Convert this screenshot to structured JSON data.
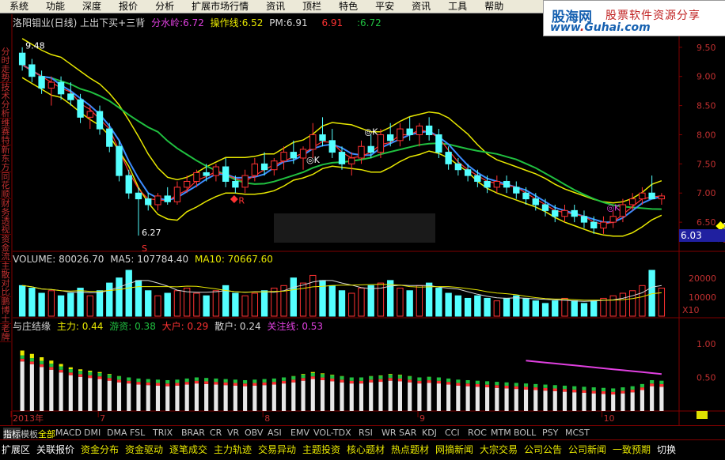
{
  "menu": [
    "系统",
    "功能",
    "深度",
    "报价",
    "分析",
    "扩展市场行情",
    "资讯",
    "顶栏",
    "特色",
    "平安",
    "资讯",
    "工具",
    "帮助"
  ],
  "menu_right": "交",
  "logo": {
    "brand": "股海网",
    "tagline": "股票软件资源分享",
    "url_left": "www",
    "url_dot": ".",
    "url_right": "Guhai.com"
  },
  "sidebar_tabs": [
    "分时走势",
    "技术分析",
    "维赛特",
    "新东方",
    "同花顺",
    "财务透视",
    "资金流",
    "主散对比",
    "鹏博士",
    "老牌"
  ],
  "title_line": {
    "name": "洛阳钼业(日线) 上出下买+三背",
    "fsl_label": "分水岭:",
    "fsl_value": "6.72",
    "czx_label": "操作线:",
    "czx_value": "6.52",
    "pm_label": "PM:",
    "pm_value": "6.91",
    "v1": "6.91",
    "v2": ":6.72"
  },
  "current_price": "6.03",
  "volume_label": {
    "vol": "VOLUME: 80026.70",
    "ma5": "MA5: 107784.40",
    "ma10": "MA10: 70667.60"
  },
  "zl_label": {
    "name": "与庄结缘",
    "zl": "主力: 0.44",
    "yz": "游资: 0.38",
    "dh": "大户: 0.29",
    "sh": "散户: 0.24",
    "gz": "关注线: 0.53"
  },
  "bottombar1": [
    "指标",
    "模板",
    "全部",
    "MACD",
    "DMI",
    "DMA",
    "FSL",
    "TRIX",
    "BRAR",
    "CR",
    "VR",
    "OBV",
    "ASI",
    "EMV",
    "VOL-TDX",
    "RSI",
    "WR",
    "SAR",
    "KDJ",
    "CCI",
    "ROC",
    "MTM",
    "BOLL",
    "PSY",
    "MCST"
  ],
  "bottombar2": [
    "扩展区",
    "关联报价",
    "资金分布",
    "资金驱动",
    "逐笔成交",
    "主力轨迹",
    "交易异动",
    "主题投资",
    "核心题材",
    "热点题材",
    "网摘新闻",
    "大宗交易",
    "公司公告",
    "公司新闻",
    "一致预期",
    "切换"
  ],
  "colors": {
    "up": "#ff3232",
    "down": "#54ffff",
    "ma_green": "#20c040",
    "ma_yellow": "#e8e800",
    "ma_blue": "#3c8cff",
    "pink": "#e040e0"
  },
  "chart_data": {
    "type": "candlestick",
    "price_axis": {
      "ticks": [
        6.5,
        7.0,
        7.5,
        8.0,
        8.5,
        9.0,
        9.5
      ],
      "ylim": [
        6.0,
        9.85
      ]
    },
    "volume_axis": {
      "ticks": [
        10000,
        20000
      ],
      "unit_label": "X10",
      "ylim": [
        0,
        22000
      ]
    },
    "zl_axis": {
      "ticks": [
        0.5,
        1.0
      ],
      "ylim": [
        0,
        1.2
      ]
    },
    "x_labels": [
      "2013年",
      "7",
      "8",
      "9",
      "10"
    ],
    "annotations": [
      {
        "text": "9.48",
        "bar": 0,
        "price": 9.48
      },
      {
        "text": "6.27",
        "bar": 12,
        "price": 6.27
      },
      {
        "text": "S",
        "bar": 12,
        "price": 6.0
      },
      {
        "text": "R",
        "bar": 22,
        "price": 6.82
      },
      {
        "text": "◎K",
        "bar": 29,
        "price": 7.52
      },
      {
        "text": "◎K",
        "bar": 35,
        "price": 8.0
      },
      {
        "text": "◎K",
        "bar": 60,
        "price": 6.7
      },
      {
        "text": "M",
        "bar": 72,
        "price": 6.38
      },
      {
        "text": "R",
        "bar": 72,
        "price": 6.15
      }
    ],
    "candles": [
      [
        9.4,
        9.5,
        9.1,
        9.2
      ],
      [
        9.2,
        9.3,
        8.9,
        9.0
      ],
      [
        9.0,
        9.1,
        8.7,
        8.8
      ],
      [
        8.8,
        9.0,
        8.5,
        8.9
      ],
      [
        8.9,
        9.0,
        8.6,
        8.7
      ],
      [
        8.7,
        8.9,
        8.5,
        8.6
      ],
      [
        8.6,
        8.7,
        8.2,
        8.3
      ],
      [
        8.3,
        8.5,
        8.1,
        8.4
      ],
      [
        8.4,
        8.5,
        8.0,
        8.1
      ],
      [
        8.1,
        8.2,
        7.7,
        7.8
      ],
      [
        7.8,
        7.9,
        7.2,
        7.3
      ],
      [
        7.3,
        7.4,
        6.9,
        7.0
      ],
      [
        7.0,
        7.1,
        6.27,
        6.9
      ],
      [
        6.9,
        7.0,
        6.7,
        6.8
      ],
      [
        6.8,
        7.0,
        6.7,
        6.95
      ],
      [
        6.95,
        7.1,
        6.8,
        6.85
      ],
      [
        6.85,
        7.2,
        6.8,
        7.1
      ],
      [
        7.1,
        7.3,
        7.0,
        7.2
      ],
      [
        7.2,
        7.4,
        7.1,
        7.35
      ],
      [
        7.35,
        7.5,
        7.2,
        7.3
      ],
      [
        7.3,
        7.5,
        7.2,
        7.45
      ],
      [
        7.45,
        7.6,
        7.1,
        7.2
      ],
      [
        7.2,
        7.3,
        7.0,
        7.1
      ],
      [
        7.1,
        7.4,
        7.0,
        7.3
      ],
      [
        7.3,
        7.6,
        7.2,
        7.5
      ],
      [
        7.5,
        7.7,
        7.3,
        7.4
      ],
      [
        7.4,
        7.6,
        7.3,
        7.55
      ],
      [
        7.55,
        7.8,
        7.4,
        7.7
      ],
      [
        7.7,
        7.9,
        7.5,
        7.6
      ],
      [
        7.6,
        7.8,
        7.4,
        7.75
      ],
      [
        7.75,
        8.2,
        7.6,
        8.0
      ],
      [
        8.0,
        8.3,
        7.8,
        7.9
      ],
      [
        7.9,
        8.1,
        7.6,
        7.7
      ],
      [
        7.7,
        7.8,
        7.4,
        7.5
      ],
      [
        7.5,
        7.7,
        7.3,
        7.6
      ],
      [
        7.6,
        7.9,
        7.5,
        7.8
      ],
      [
        7.8,
        8.0,
        7.6,
        7.7
      ],
      [
        7.7,
        8.1,
        7.6,
        8.0
      ],
      [
        8.0,
        8.2,
        7.8,
        7.9
      ],
      [
        7.9,
        8.2,
        7.8,
        8.1
      ],
      [
        8.1,
        8.3,
        7.9,
        8.0
      ],
      [
        8.0,
        8.2,
        7.8,
        8.15
      ],
      [
        8.15,
        8.3,
        7.9,
        8.0
      ],
      [
        8.0,
        8.1,
        7.6,
        7.7
      ],
      [
        7.7,
        7.8,
        7.4,
        7.5
      ],
      [
        7.5,
        7.6,
        7.3,
        7.4
      ],
      [
        7.4,
        7.5,
        7.2,
        7.3
      ],
      [
        7.3,
        7.4,
        7.1,
        7.2
      ],
      [
        7.2,
        7.3,
        7.0,
        7.1
      ],
      [
        7.1,
        7.3,
        7.0,
        7.2
      ],
      [
        7.2,
        7.3,
        7.0,
        7.1
      ],
      [
        7.1,
        7.2,
        6.9,
        7.0
      ],
      [
        7.0,
        7.1,
        6.8,
        6.9
      ],
      [
        6.9,
        7.0,
        6.7,
        6.8
      ],
      [
        6.8,
        6.9,
        6.6,
        6.7
      ],
      [
        6.7,
        6.8,
        6.5,
        6.6
      ],
      [
        6.6,
        6.8,
        6.5,
        6.7
      ],
      [
        6.7,
        6.8,
        6.5,
        6.6
      ],
      [
        6.6,
        6.7,
        6.4,
        6.5
      ],
      [
        6.5,
        6.6,
        6.3,
        6.4
      ],
      [
        6.4,
        6.6,
        6.3,
        6.5
      ],
      [
        6.5,
        6.7,
        6.4,
        6.6
      ],
      [
        6.6,
        6.9,
        6.5,
        6.8
      ],
      [
        6.8,
        7.0,
        6.7,
        6.9
      ],
      [
        6.9,
        7.1,
        6.8,
        7.0
      ],
      [
        7.0,
        7.3,
        6.9,
        6.9
      ],
      [
        6.9,
        7.0,
        6.8,
        6.95
      ]
    ],
    "volumes": [
      12,
      11,
      9,
      10,
      8,
      9,
      11,
      8,
      10,
      13,
      15,
      18,
      14,
      10,
      8,
      9,
      10,
      11,
      9,
      8,
      10,
      12,
      9,
      8,
      9,
      10,
      11,
      12,
      15,
      13,
      16,
      14,
      12,
      10,
      9,
      11,
      12,
      13,
      14,
      11,
      10,
      12,
      13,
      11,
      9,
      8,
      7,
      8,
      7,
      6,
      7,
      8,
      7,
      6,
      5,
      6,
      7,
      6,
      5,
      6,
      7,
      8,
      9,
      10,
      12,
      18,
      11
    ],
    "zl_values": [
      0.9,
      0.85,
      0.8,
      0.75,
      0.7,
      0.65,
      0.62,
      0.6,
      0.58,
      0.55,
      0.52,
      0.5,
      0.48,
      0.47,
      0.46,
      0.45,
      0.46,
      0.48,
      0.5,
      0.49,
      0.48,
      0.47,
      0.46,
      0.45,
      0.46,
      0.47,
      0.48,
      0.5,
      0.52,
      0.55,
      0.58,
      0.56,
      0.54,
      0.52,
      0.5,
      0.5,
      0.52,
      0.53,
      0.55,
      0.54,
      0.52,
      0.5,
      0.51,
      0.5,
      0.48,
      0.46,
      0.45,
      0.44,
      0.43,
      0.42,
      0.41,
      0.4,
      0.39,
      0.38,
      0.37,
      0.36,
      0.35,
      0.34,
      0.33,
      0.32,
      0.31,
      0.3,
      0.32,
      0.34,
      0.38,
      0.45,
      0.44
    ],
    "gz_line": {
      "start_bar": 52,
      "values_start": 0.75,
      "values_end": 0.55
    }
  }
}
